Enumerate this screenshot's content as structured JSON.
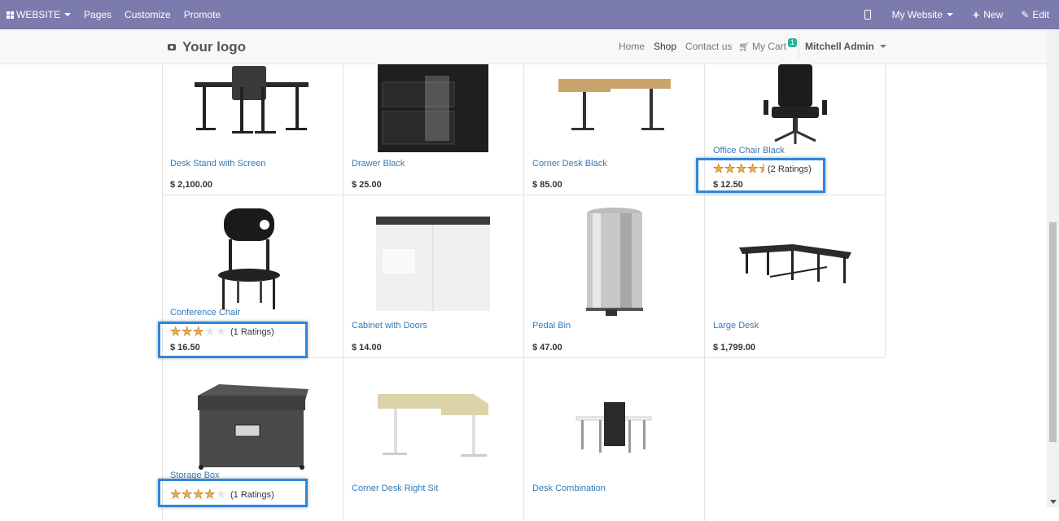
{
  "topbar": {
    "website_label": "WEBSITE",
    "pages": "Pages",
    "customize": "Customize",
    "promote": "Promote",
    "my_website": "My Website",
    "new": "New",
    "edit": "Edit"
  },
  "header": {
    "logo": "Your logo",
    "home": "Home",
    "shop": "Shop",
    "contact": "Contact us",
    "cart": "My Cart",
    "cart_count": "1",
    "user": "Mitchell Admin"
  },
  "products": [
    {
      "name": "Desk Stand with Screen",
      "price": "$ 2,100.00"
    },
    {
      "name": "Drawer Black",
      "price": "$ 25.00"
    },
    {
      "name": "Corner Desk Black",
      "price": "$ 85.00"
    },
    {
      "name": "Office Chair Black",
      "price": "$ 12.50",
      "rating_text": "(2 Ratings)",
      "stars": 4.5
    },
    {
      "name": "Conference Chair",
      "price": "$ 16.50",
      "rating_text": "(1 Ratings)",
      "stars": 3
    },
    {
      "name": "Cabinet with Doors",
      "price": "$ 14.00"
    },
    {
      "name": "Pedal Bin",
      "price": "$ 47.00"
    },
    {
      "name": "Large Desk",
      "price": "$ 1,799.00"
    },
    {
      "name": "Storage Box",
      "rating_text": "(1 Ratings)",
      "stars": 4
    },
    {
      "name": "Corner Desk Right Sit"
    },
    {
      "name": "Desk Combination"
    }
  ],
  "colors": {
    "topbar": "#7c7bad",
    "link": "#337ab7",
    "highlight": "#2f86d8",
    "star": "#f0ad4e",
    "badge": "#21b799"
  }
}
